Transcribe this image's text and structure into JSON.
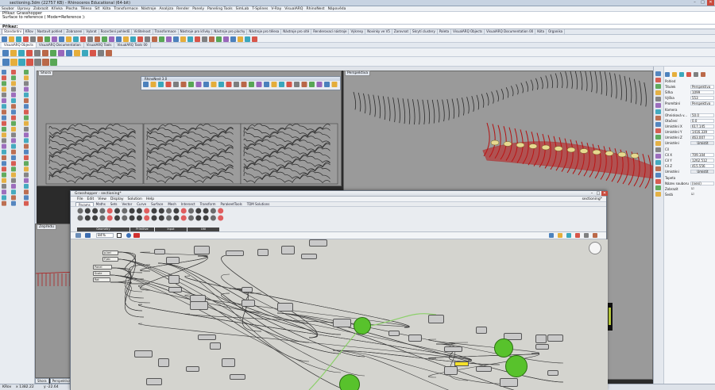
{
  "window": {
    "title": "sectioning.3dm (22757 KB) - Rhinoceros Educational (64-bit)",
    "min": "–",
    "max": "□",
    "close": "✕"
  },
  "menubar": [
    "Soubor",
    "Úpravy",
    "Zobrazit",
    "Křivka",
    "Plocha",
    "Těleso",
    "Síť",
    "Kóta",
    "Transformace",
    "Nástroje",
    "Analýza",
    "Render",
    "Panely",
    "Paneling Tools",
    "SimLab",
    "T-Splines",
    "V-Ray",
    "VisualARQ",
    "RhinoNest",
    "Nápověda"
  ],
  "command_history": [
    "Příkaz: Grasshopper",
    "Surface to reference ( Mode=Reference ):"
  ],
  "command_prompt": "Příkaz:",
  "toolbar_tabs": [
    "Standardní",
    "KRov",
    "Nastavit pohled",
    "Zobrazení",
    "Vybrat",
    "Rozvržení pohledů",
    "Viditelnost",
    "Transformace",
    "Nástroje pro křivky",
    "Nástroje pro plochy",
    "Nástroje pro tělesa",
    "Nástroje pro sítě",
    "Renderovací nástroje",
    "Výkresy",
    "Novinky ve V5",
    "Zarovnat",
    "Skrytí clustery",
    "Paleta",
    "VisualARQ Objects",
    "VisualARQ Documentation 00",
    "Kóta",
    "Organika"
  ],
  "toolbar_tabs2": [
    "VisualARQ Objects",
    "VisualARQ Documentation",
    "VisualARQ Tools",
    "VisualARQ Tools 00"
  ],
  "viewports": {
    "top": "Shora",
    "perspective": "Perspektiva",
    "front": "Zepředu"
  },
  "floating_toolbar": {
    "title": "RhinoNest 3.0"
  },
  "viewport_tabs": [
    "Shora",
    "Perspektiva"
  ],
  "status": {
    "cplane": "KRov",
    "x": "x 1382.22",
    "y": "y -22.64"
  },
  "properties": {
    "section_view": "Pohled",
    "rows": [
      {
        "k": "Titulek",
        "v": "Perspektiva"
      },
      {
        "k": "Šířka",
        "v": "1099"
      },
      {
        "k": "Výška",
        "v": "553"
      },
      {
        "k": "Promítání",
        "v": "Perspektiva"
      }
    ],
    "section_camera": "Kamera",
    "camera_rows": [
      {
        "k": "Ohnisková v...",
        "v": "50.0"
      },
      {
        "k": "Otočení",
        "v": "0.0"
      },
      {
        "k": "Umístění X",
        "v": "617.145"
      },
      {
        "k": "Umístění Y",
        "v": "1416.339"
      },
      {
        "k": "Umístění Z",
        "v": "463.007"
      },
      {
        "k": "Umístění",
        "v": "Umístit"
      }
    ],
    "section_target": "Cíl",
    "target_rows": [
      {
        "k": "Cíl X",
        "v": "709.104"
      },
      {
        "k": "Cíl Y",
        "v": "1262.512"
      },
      {
        "k": "Cíl Z",
        "v": "415.556"
      },
      {
        "k": "Umístění",
        "v": "Umístit"
      }
    ],
    "section_wallpaper": "Tapeta",
    "wallpaper_rows": [
      {
        "k": "Název souboru",
        "v": "(není)"
      },
      {
        "k": "Zobrazit",
        "v": "☑"
      },
      {
        "k": "Šedá",
        "v": "☑"
      }
    ]
  },
  "grasshopper": {
    "title": "Grasshopper - sectioning*",
    "menu": [
      "File",
      "Edit",
      "View",
      "Display",
      "Solution",
      "Help"
    ],
    "document": "sectioning*",
    "tabs": [
      "Params",
      "Maths",
      "Sets",
      "Vector",
      "Curve",
      "Surface",
      "Mesh",
      "Intersect",
      "Transform",
      "ParakeetTools",
      "TDM Solutions"
    ],
    "active_tab": "Params",
    "groups": [
      "Geometry",
      "Primitive",
      "Input",
      "Util"
    ],
    "zoom": "84%",
    "params": [
      "p.bel",
      "F/ab",
      "Panel",
      "Scale",
      "Rot"
    ]
  }
}
